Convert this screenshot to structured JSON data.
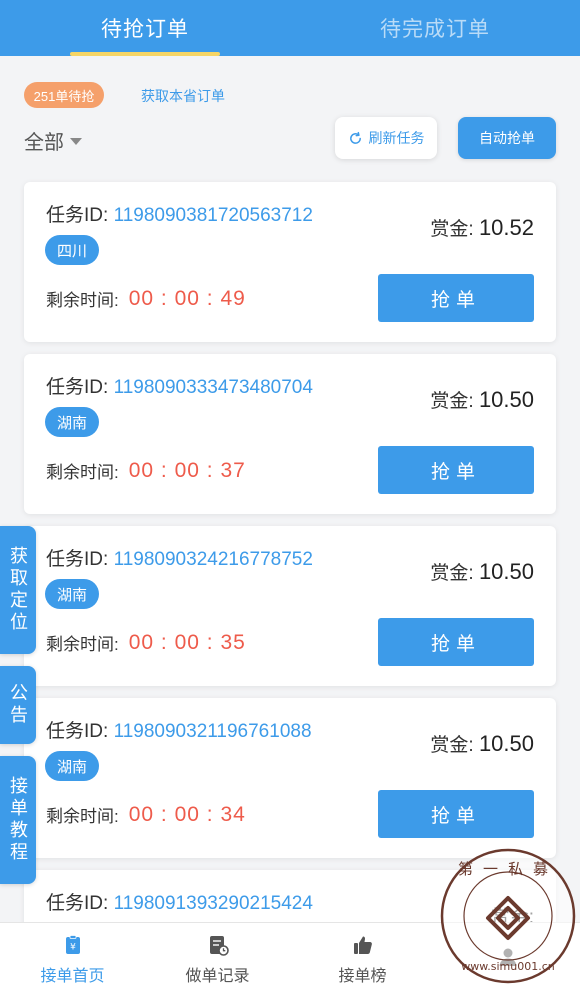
{
  "tabs": [
    {
      "label": "待抢订单",
      "active": true
    },
    {
      "label": "待完成订单",
      "active": false
    }
  ],
  "pending_badge": "251单待抢",
  "get_province_link": "获取本省订单",
  "filter_label": "全部",
  "refresh_label": "刷新任务",
  "auto_grab_label": "自动抢单",
  "task_labels": {
    "id_label": "任务ID:",
    "reward_label": "赏金:",
    "remain_label": "剩余时间:",
    "grab_label": "抢单"
  },
  "tasks": [
    {
      "id": "1198090381720563712",
      "province": "四川",
      "reward": "10.52",
      "remaining": "00 : 00 : 49"
    },
    {
      "id": "1198090333473480704",
      "province": "湖南",
      "reward": "10.50",
      "remaining": "00 : 00 : 37"
    },
    {
      "id": "1198090324216778752",
      "province": "湖南",
      "reward": "10.50",
      "remaining": "00 : 00 : 35"
    },
    {
      "id": "1198090321196761088",
      "province": "湖南",
      "reward": "10.50",
      "remaining": "00 : 00 : 34"
    },
    {
      "id": "1198091393290215424",
      "province": "",
      "reward": "",
      "remaining": ""
    }
  ],
  "side_tabs": [
    "获取定位",
    "公告",
    "接单教程"
  ],
  "bottom_nav": [
    {
      "label": "接单首页",
      "icon": "order-home-icon",
      "active": true
    },
    {
      "label": "做单记录",
      "icon": "record-icon",
      "active": false
    },
    {
      "label": "接单榜",
      "icon": "thumbs-up-icon",
      "active": false
    },
    {
      "label": "",
      "icon": "user-icon",
      "active": false
    }
  ],
  "watermark": {
    "name": "第一私募",
    "url": "www.simu001.cn"
  },
  "colors": {
    "primary": "#3d9be9",
    "accent": "#f6d565",
    "timer": "#ee5b4b",
    "badge": "#f5a06b"
  }
}
